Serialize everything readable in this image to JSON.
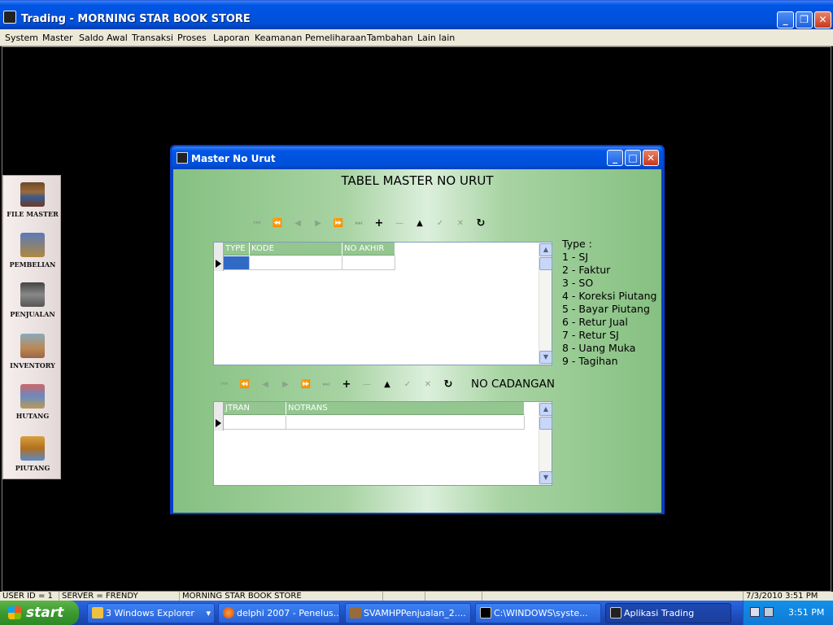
{
  "app": {
    "title": "Trading - MORNING STAR BOOK STORE",
    "menu": [
      "System",
      "Master",
      "Saldo Awal",
      "Transaksi",
      "Proses",
      "Laporan",
      "Keamanan",
      "Pemeliharaan",
      "Tambahan",
      "Lain lain"
    ]
  },
  "sidebar": {
    "items": [
      {
        "label": "FILE MASTER",
        "icon": "books-icon"
      },
      {
        "label": "PEMBELIAN",
        "icon": "shopping-bag-icon"
      },
      {
        "label": "PENJUALAN",
        "icon": "cash-register-icon"
      },
      {
        "label": "INVENTORY",
        "icon": "clipboard-icon"
      },
      {
        "label": "HUTANG",
        "icon": "ledger-icon"
      },
      {
        "label": "PIUTANG",
        "icon": "coins-icon"
      }
    ]
  },
  "dialog": {
    "title": "Master No Urut",
    "heading": "TABEL MASTER NO URUT",
    "grid1": {
      "columns": [
        "TYPE",
        "KODE",
        "NO AKHIR"
      ]
    },
    "type_list": [
      "Type :",
      "1 - SJ",
      "2 - Faktur",
      "3 - SO",
      "4 - Koreksi Piutang",
      "5 - Bayar Piutang",
      "6 - Retur Jual",
      "7 - Retur SJ",
      "8 - Uang Muka",
      "9 - Tagihan"
    ],
    "section2_label": "NO CADANGAN",
    "grid2": {
      "columns": [
        "JTRAN",
        "NOTRANS"
      ]
    },
    "nav_icons": [
      "first-icon",
      "prior-page-icon",
      "prior-icon",
      "next-icon",
      "next-page-icon",
      "last-icon",
      "insert-icon",
      "delete-icon",
      "edit-icon",
      "post-icon",
      "cancel-icon",
      "refresh-icon"
    ]
  },
  "statusbar": [
    "USER ID = 1",
    "SERVER = FRENDY",
    "MORNING STAR BOOK STORE",
    "",
    "",
    "",
    "7/3/2010 3:51 PM"
  ],
  "taskbar": {
    "start": "start",
    "buttons": [
      "3 Windows Explorer",
      "delphi 2007 - Penelus...",
      "SVAMHPPenjualan_2....",
      "C:\\WINDOWS\\syste...",
      "Aplikasi Trading"
    ],
    "clock": "3:51 PM"
  },
  "colors": {
    "xp_blue": "#0055e5",
    "dialog_green": "#86c081",
    "grid_header": "#94c690"
  }
}
